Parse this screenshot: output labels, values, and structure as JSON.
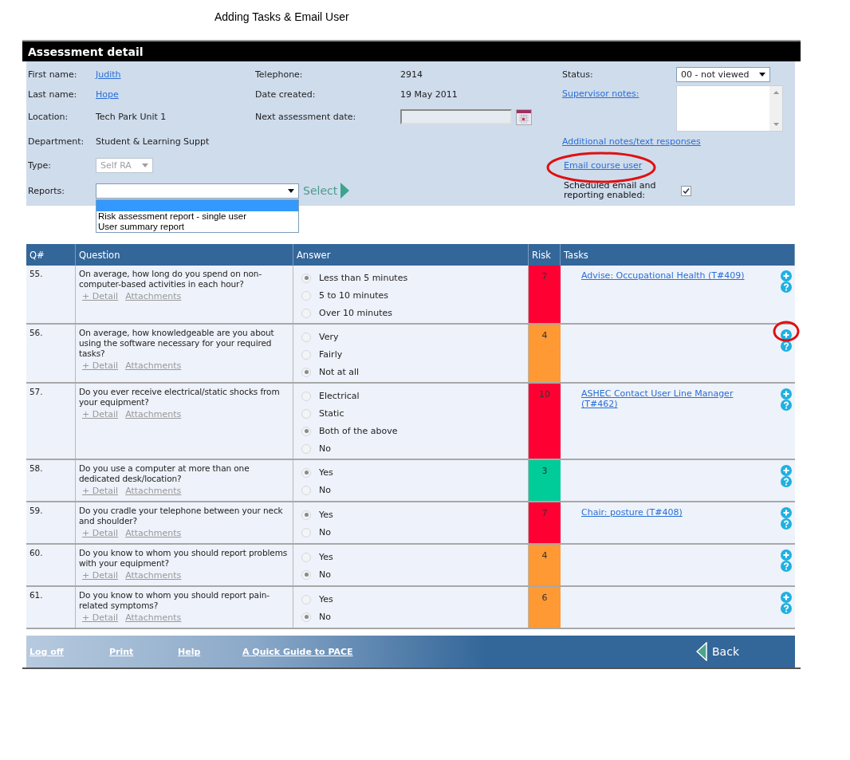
{
  "caption": "Adding Tasks & Email User",
  "title": "Assessment detail",
  "details": {
    "first_name": {
      "label": "First name:",
      "value": "Judith"
    },
    "last_name": {
      "label": "Last name:",
      "value": "Hope"
    },
    "location": {
      "label": "Location:",
      "value": "Tech Park Unit 1"
    },
    "department": {
      "label": "Department:",
      "value": "Student & Learning Suppt"
    },
    "type": {
      "label": "Type:",
      "value": "Self RA",
      "disabled": true
    },
    "reports": {
      "label": "Reports:",
      "expanded": true,
      "button": "Select",
      "options": [
        {
          "selected": true
        },
        {
          "label": "Risk assessment report - single user",
          "selected": false
        },
        {
          "label": "User summary report",
          "selected": false
        }
      ]
    },
    "telephone": {
      "label": "Telephone:",
      "value": "2914"
    },
    "date_created": {
      "label": "Date created:",
      "value": "19 May 2011"
    },
    "next_assessment": {
      "label": "Next assessment date:",
      "disabled": true
    },
    "status": {
      "label": "Status:",
      "value": "00 - not viewed"
    },
    "supervisor_notes": {
      "label": "Supervisor notes:"
    },
    "additional_notes_link": "Additional notes/text responses",
    "email_link": "Email course user",
    "scheduled": {
      "label": "Scheduled email and reporting enabled:",
      "checked": true
    }
  },
  "table": {
    "columns": [
      "Q#",
      "Question",
      "Answer",
      "Risk",
      "Tasks"
    ],
    "rows": [
      {
        "number": "55.",
        "question": "On average, how long do you spend on non-computer-based activities in each hour?",
        "links": [
          "+ Detail",
          "Attachments"
        ],
        "answers": [
          {
            "label": "Less than 5 minutes",
            "selected": true
          },
          {
            "label": "5 to 10 minutes",
            "selected": false
          },
          {
            "label": "Over 10 minutes",
            "selected": false
          }
        ],
        "risk": "7",
        "color": "#ff0033",
        "tasks": [
          "Advise: Occupational Health (T#409)"
        ]
      },
      {
        "number": "56.",
        "question": "On average, how knowledgeable are you about using the software necessary for your required tasks?",
        "links": [
          "+ Detail",
          "Attachments"
        ],
        "answers": [
          {
            "label": "Very",
            "selected": false
          },
          {
            "label": "Fairly",
            "selected": false
          },
          {
            "label": "Not at all",
            "selected": true
          }
        ],
        "risk": "4",
        "color": "#ff9933",
        "tasks": []
      },
      {
        "number": "57.",
        "question": "Do you ever receive electrical/static shocks from your equipment?",
        "links": [
          "+ Detail",
          "Attachments"
        ],
        "answers": [
          {
            "label": "Electrical",
            "selected": false
          },
          {
            "label": "Static",
            "selected": false
          },
          {
            "label": "Both of the above",
            "selected": true
          },
          {
            "label": "No",
            "selected": false
          }
        ],
        "risk": "10",
        "color": "#ff0033",
        "tasks": [
          "ASHEC Contact User Line Manager (T#462)"
        ]
      },
      {
        "number": "58.",
        "question": "Do you use a computer at more than one dedicated desk/location?",
        "links": [
          "+ Detail",
          "Attachments"
        ],
        "answers": [
          {
            "label": "Yes",
            "selected": true
          },
          {
            "label": "No",
            "selected": false
          }
        ],
        "risk": "3",
        "color": "#00cc99",
        "tasks": []
      },
      {
        "number": "59.",
        "question": "Do you cradle your telephone between your neck and shoulder?",
        "links": [
          "+ Detail",
          "Attachments"
        ],
        "answers": [
          {
            "label": "Yes",
            "selected": true
          },
          {
            "label": "No",
            "selected": false
          }
        ],
        "risk": "7",
        "color": "#ff0033",
        "tasks": [
          "Chair: posture (T#408)"
        ]
      },
      {
        "number": "60.",
        "question": "Do you know to whom you should report problems with your equipment?",
        "links": [
          "+ Detail",
          "Attachments"
        ],
        "answers": [
          {
            "label": "Yes",
            "selected": false
          },
          {
            "label": "No",
            "selected": true
          }
        ],
        "risk": "4",
        "color": "#ff9933",
        "tasks": []
      },
      {
        "number": "61.",
        "question": "Do you know to whom you should report pain-related symptoms?",
        "links": [
          "+ Detail",
          "Attachments"
        ],
        "answers": [
          {
            "label": "Yes",
            "selected": false
          },
          {
            "label": "No",
            "selected": true
          }
        ],
        "risk": "6",
        "color": "#ff9933",
        "tasks": []
      }
    ]
  },
  "footer": {
    "links": [
      "Log off",
      "Print",
      "Help",
      "A Quick Guide to PACE"
    ],
    "back": "Back"
  }
}
